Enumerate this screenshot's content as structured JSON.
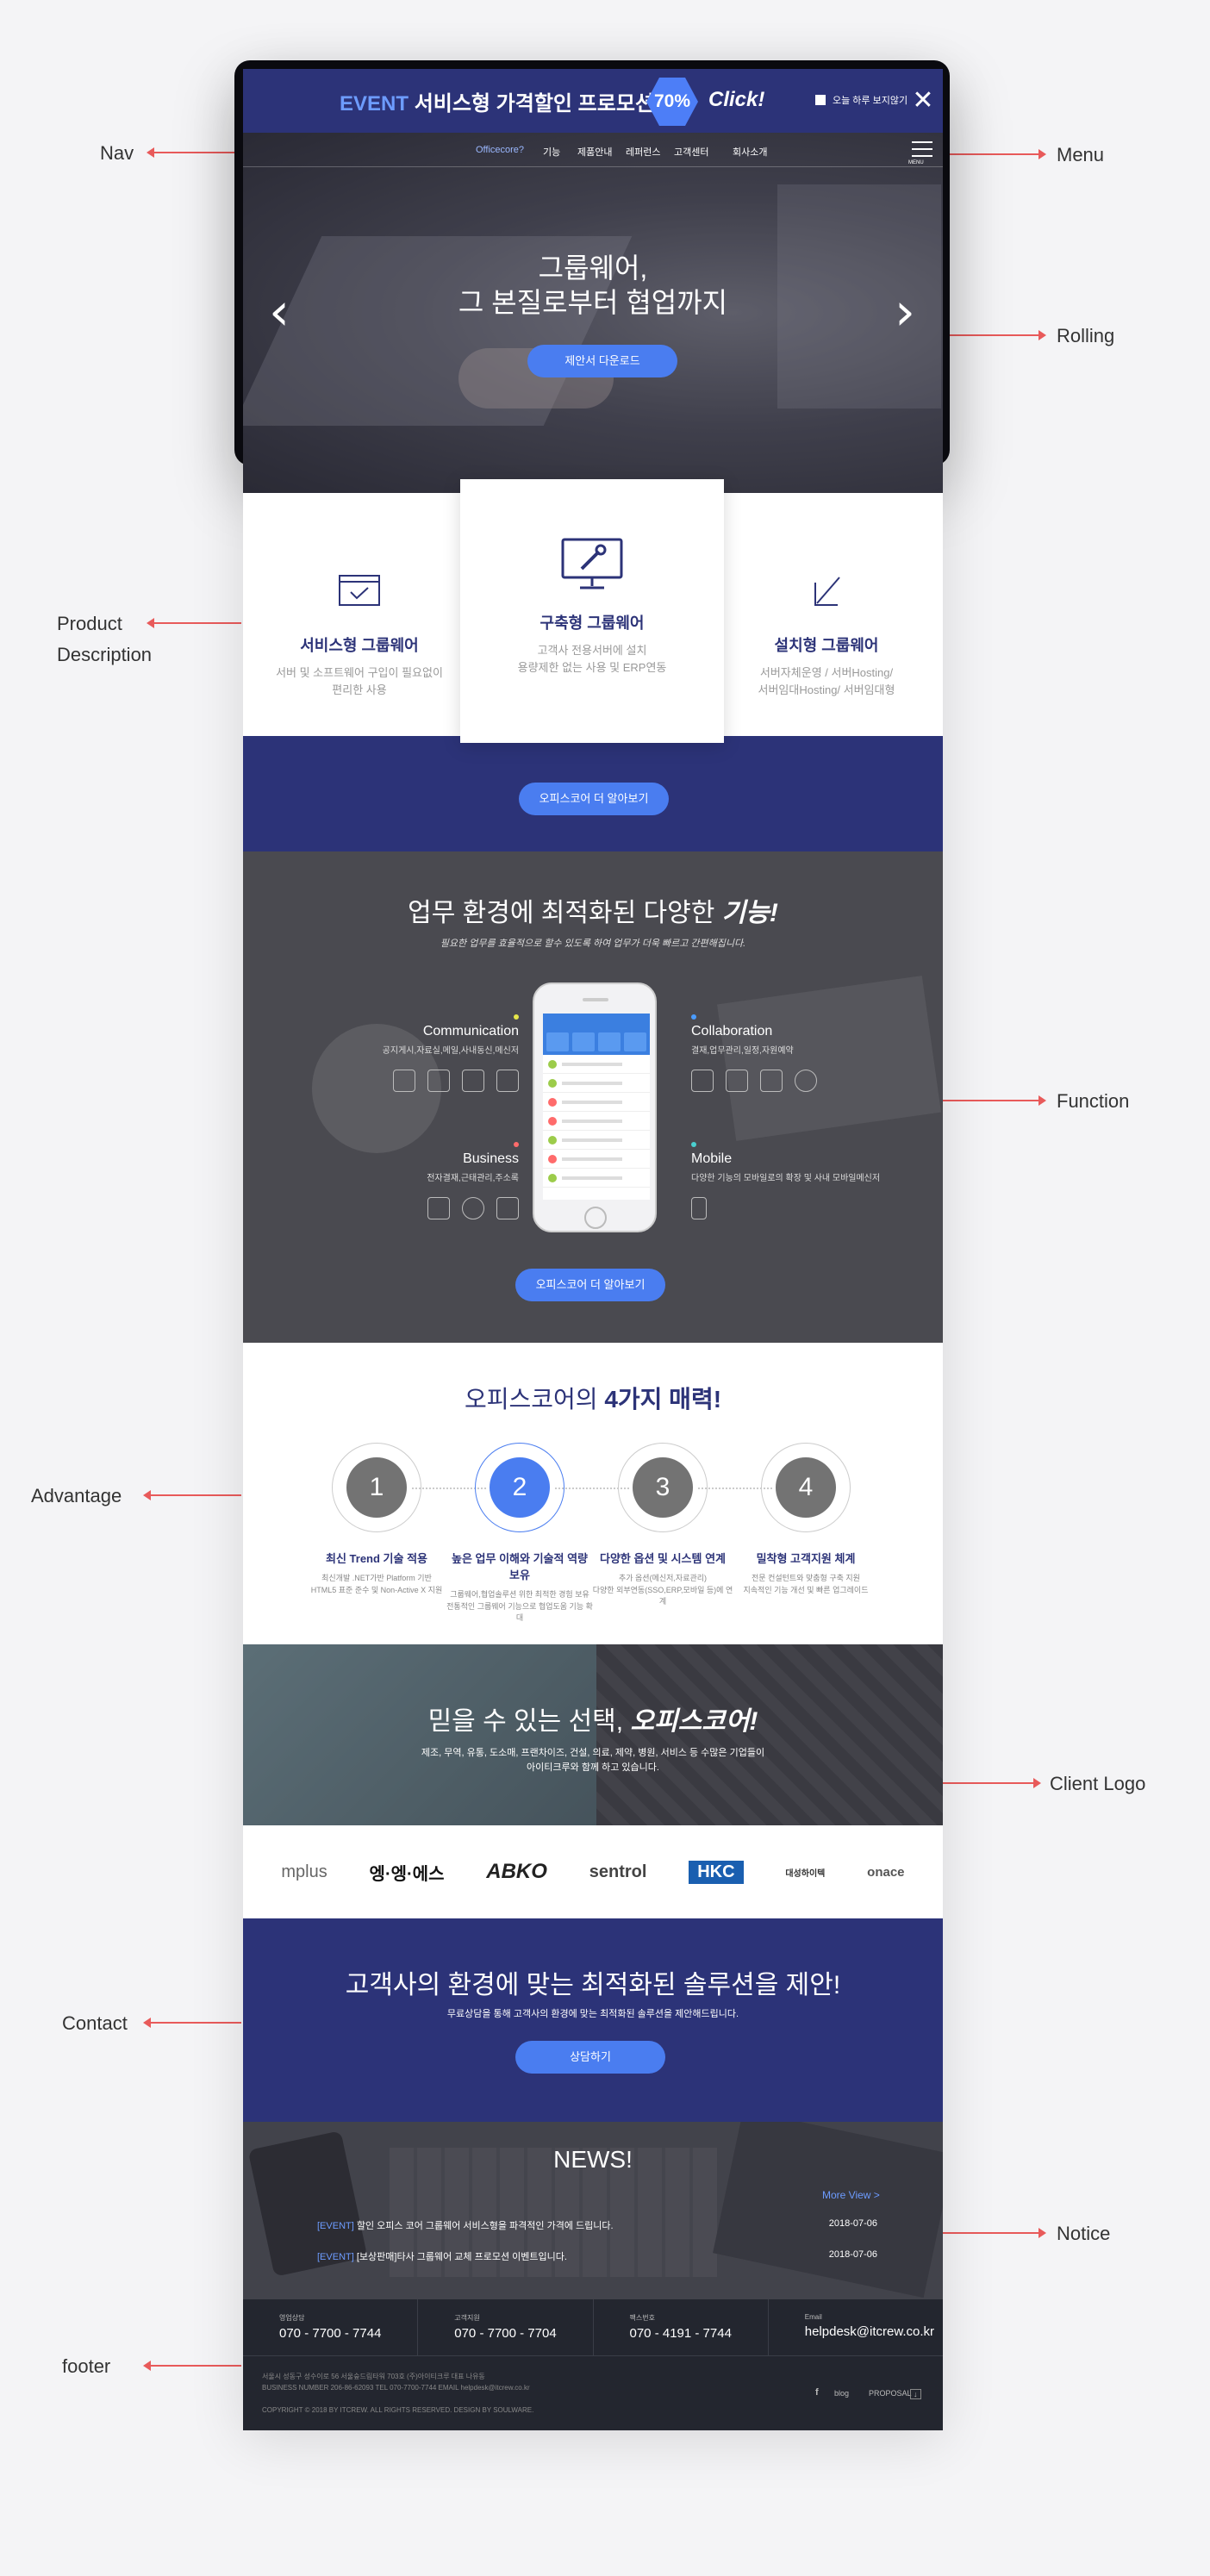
{
  "annotations": {
    "nav": "Nav",
    "menu": "Menu",
    "rolling": "Rolling",
    "product_description": [
      "Product",
      "Description"
    ],
    "function": "Function",
    "advantage": "Advantage",
    "client_logo": "Client Logo",
    "contact": "Contact",
    "notice": "Notice",
    "footer": "footer"
  },
  "event_bar": {
    "event_word": "EVENT",
    "text": "서비스형 가격할인 프로모션 !",
    "badge": "70%",
    "click": "Click!",
    "checkbox_label": "오늘 하루 보지않기",
    "close": "✕"
  },
  "nav": {
    "logo": "Officecore?",
    "items": [
      "기능",
      "제품안내",
      "레퍼런스",
      "고객센터",
      "회사소개"
    ],
    "menu_label": "MENU"
  },
  "hero": {
    "title_line1": "그룹웨어,",
    "title_line2": "그 본질로부터 협업까지",
    "button": "제안서 다운로드",
    "prev": "‹",
    "next": "›"
  },
  "products": [
    {
      "title": "서비스형 그룹웨어",
      "desc_line1": "서버 및 소프트웨어 구입이 필요없이",
      "desc_line2": "편리한 사용"
    },
    {
      "title": "구축형 그룹웨어",
      "desc_line1": "고객사 전용서버에 설치",
      "desc_line2": "용량제한 없는 사용 및 ERP연동"
    },
    {
      "title": "설치형 그룹웨어",
      "desc_line1": "서버자체운영 / 서버Hosting/",
      "desc_line2": "서버임대Hosting/ 서버임대형"
    }
  ],
  "more_button": "오피스코어 더 알아보기",
  "function": {
    "title_plain": "업무 환경에 최적화된 다양한 ",
    "title_em": "기능!",
    "subtitle": "필요한 업무를 효율적으로 할수 있도록 하여 업무가 더욱 빠르고 간편해집니다.",
    "features": [
      {
        "title": "Communication",
        "desc": "공지게시,자료실,메일,사내동신,메신저",
        "dot": "#e6e64a"
      },
      {
        "title": "Collaboration",
        "desc": "결재,업무관리,일정,자원예약",
        "dot": "#4a9cff"
      },
      {
        "title": "Business",
        "desc": "전자결재,근태관리,주소록",
        "dot": "#ff6b6b"
      },
      {
        "title": "Mobile",
        "desc": "다양한 기능의 모바일로의 확장 및 사내 모바일메신저",
        "dot": "#4ad0d0"
      }
    ],
    "button": "오피스코어 더 알아보기"
  },
  "advantage": {
    "title_plain": "오피스코어의 ",
    "title_bold": "4가지 매력!",
    "items": [
      {
        "num": "1",
        "name": "최신 Trend 기술 적용",
        "desc_line1": "최신개발 .NET가반 Platform 기반",
        "desc_line2": "HTML5 표준 준수 및 Non-Active X 지원"
      },
      {
        "num": "2",
        "name": "높은 업무 이해와 기술적 역량 보유",
        "desc_line1": "그룹웨어,협업솔루션 위한 최적한 경험 보유",
        "desc_line2": "전통적인 그룹웨어 기능으로 협업도움 기능 확대"
      },
      {
        "num": "3",
        "name": "다양한 옵션 및 시스템 연계",
        "desc_line1": "추가 옵션(메신저,자료관리)",
        "desc_line2": "다양한 외부연동(SSO,ERP,모바일 등)에 연계"
      },
      {
        "num": "4",
        "name": "밀착형 고객지원 체계",
        "desc_line1": "전문 컨설턴트와 맞춤형 구축 지원",
        "desc_line2": "지속적인 기능 개선 및 빠른 업그레이드"
      }
    ]
  },
  "client": {
    "title_plain": "믿을 수 있는 선택, ",
    "title_bold": "오피스코어!",
    "sub_line1": "제조, 무역, 유통, 도소매, 프랜차이즈, 건설, 의료, 제약, 병원, 서비스 등 수많은 기업들이",
    "sub_line2": "아이티크루와 함께 하고 있습니다.",
    "logos": [
      "mplus",
      "엥·엥·에스",
      "ABKO",
      "sentrol",
      "HKC",
      "대성하이텍",
      "onace"
    ]
  },
  "contact": {
    "title": "고객사의 환경에 맞는 최적화된 솔루션을 제안!",
    "subtitle": "무료상담을 통해 고객사의 환경에 맞는 최적화된 솔루션을 제안해드립니다.",
    "button": "상담하기"
  },
  "notice": {
    "title": "NEWS!",
    "more": "More View >",
    "items": [
      {
        "tag": "[EVENT]",
        "text": "할인 오피스 코어 그룹웨어 서비스형을 파격적인 가격에 드립니다.",
        "date": "2018-07-06"
      },
      {
        "tag": "[EVENT]",
        "text": "[보상판매]타사 그룹웨어 교체 프로모션 이벤트입니다.",
        "date": "2018-07-06"
      }
    ]
  },
  "footer": {
    "contacts": [
      {
        "label": "영업상담",
        "value": "070 - 7700 - 7744"
      },
      {
        "label": "고객지원",
        "value": "070 - 7700 - 7704"
      },
      {
        "label": "팩스번호",
        "value": "070 - 4191 - 7744"
      },
      {
        "label": "Email",
        "value": "helpdesk@itcrew.co.kr"
      }
    ],
    "address": "서울시 성동구 성수이로 56 서울숲드림타워 703호 (주)아이티크루 대표 나유동",
    "business": "BUSINESS NUMBER 206-86-62093 TEL 070-7700-7744 EMAIL helpdesk@itcrew.co.kr",
    "copyright": "COPYRIGHT © 2018 BY ITCREW. ALL RIGHTS RESERVED. DESIGN BY SOULWARE.",
    "facebook": "f",
    "blog": "blog",
    "proposal": "PROPOSAL"
  }
}
